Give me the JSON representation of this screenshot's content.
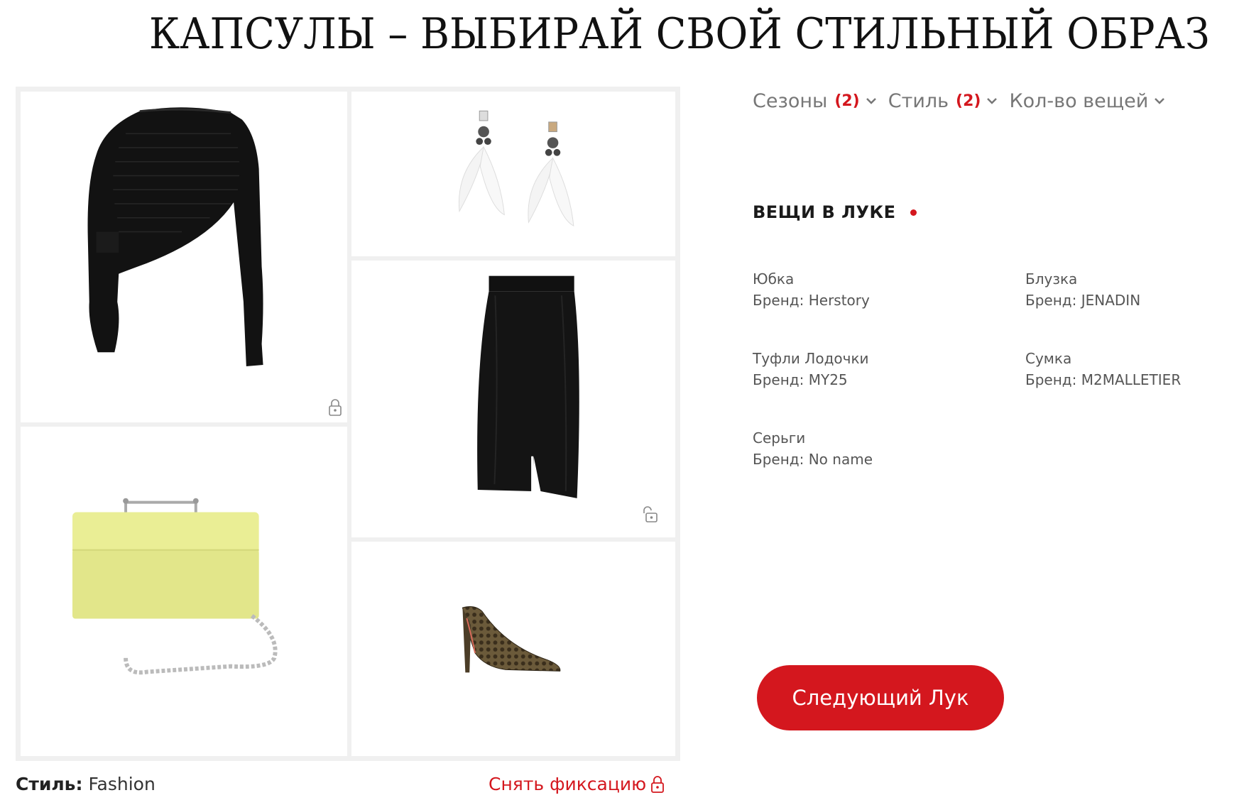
{
  "page": {
    "title": "КАПСУЛЫ – ВЫБИРАЙ СВОЙ СТИЛЬНЫЙ ОБРАЗ"
  },
  "filters": [
    {
      "label": "Сезоны",
      "count": "(2)"
    },
    {
      "label": "Стиль",
      "count": "(2)"
    },
    {
      "label": "Кол-во вещей",
      "count": ""
    }
  ],
  "look": {
    "heading": "ВЕЩИ В ЛУКЕ",
    "items": [
      {
        "name": "Юбка",
        "brand": "Бренд: Herstory"
      },
      {
        "name": "Блузка",
        "brand": "Бренд: JENADIN"
      },
      {
        "name": "Туфли Лодочки",
        "brand": "Бренд: MY25"
      },
      {
        "name": "Сумка",
        "brand": "Бренд: M2MALLETIER"
      },
      {
        "name": "Серьги",
        "brand": "Бренд: No name"
      }
    ]
  },
  "next_button": {
    "label": "Следующий Лук"
  },
  "footer": {
    "style_label": "Стиль:",
    "style_value": "Fashion",
    "unfix_label": "Снять фиксацию"
  },
  "products": [
    {
      "id": "sweater",
      "icon": "sweater-image",
      "color": "#111111"
    },
    {
      "id": "earrings",
      "icon": "earrings-image",
      "color": "#f4f4f4"
    },
    {
      "id": "skirt",
      "icon": "skirt-image",
      "color": "#111111"
    },
    {
      "id": "bag",
      "icon": "bag-image",
      "color": "#eaee95"
    },
    {
      "id": "shoe",
      "icon": "shoe-image",
      "color": "#5c4a2e"
    }
  ],
  "colors": {
    "accent": "#d4171e",
    "muted": "#777777",
    "grid_border": "#f0f0f0"
  }
}
